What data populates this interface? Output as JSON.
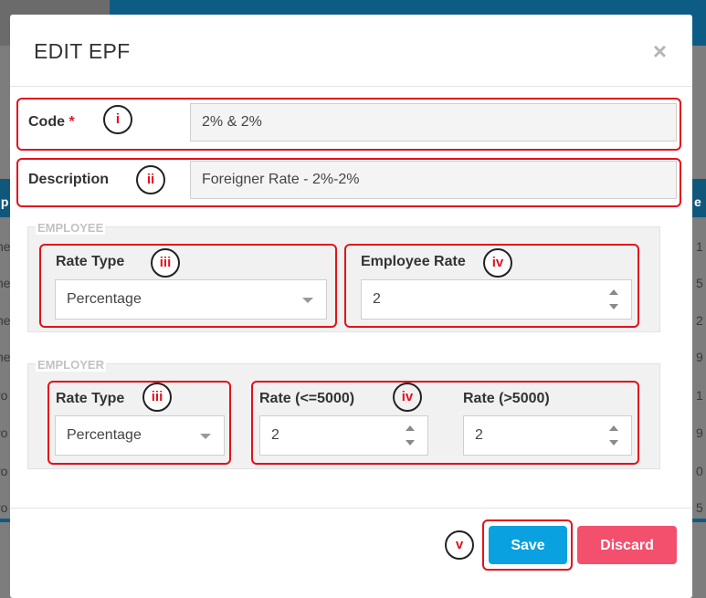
{
  "background": {
    "row_fragments": [
      "ne",
      "ne",
      "ne",
      "ne",
      "ro",
      "ro",
      "ro",
      "ro",
      "ro"
    ],
    "header_left": "ip",
    "header_right": "e",
    "right_digits": [
      "1",
      "5",
      "2",
      "9",
      "1",
      "9",
      "0",
      "5"
    ]
  },
  "modal": {
    "title": "EDIT EPF",
    "close_glyph": "×"
  },
  "code": {
    "label": "Code",
    "required": "*",
    "value": "2% & 2%"
  },
  "description": {
    "label": "Description",
    "value": "Foreigner Rate - 2%-2%"
  },
  "employee": {
    "legend": "EMPLOYEE",
    "rate_type_label": "Rate Type",
    "rate_type_value": "Percentage",
    "rate_label": "Employee Rate",
    "rate_value": "2"
  },
  "employer": {
    "legend": "EMPLOYER",
    "rate_type_label": "Rate Type",
    "rate_type_value": "Percentage",
    "rate_low_label": "Rate (<=5000)",
    "rate_low_value": "2",
    "rate_high_label": "Rate (>5000)",
    "rate_high_value": "2"
  },
  "buttons": {
    "save": "Save",
    "discard": "Discard"
  },
  "annotations": {
    "i": "i",
    "ii": "ii",
    "iii": "iii",
    "iv": "iv",
    "v": "v"
  },
  "colors": {
    "annotation_red": "#e3101c",
    "save_blue": "#0aa1e0",
    "discard_pink": "#f3506d"
  }
}
